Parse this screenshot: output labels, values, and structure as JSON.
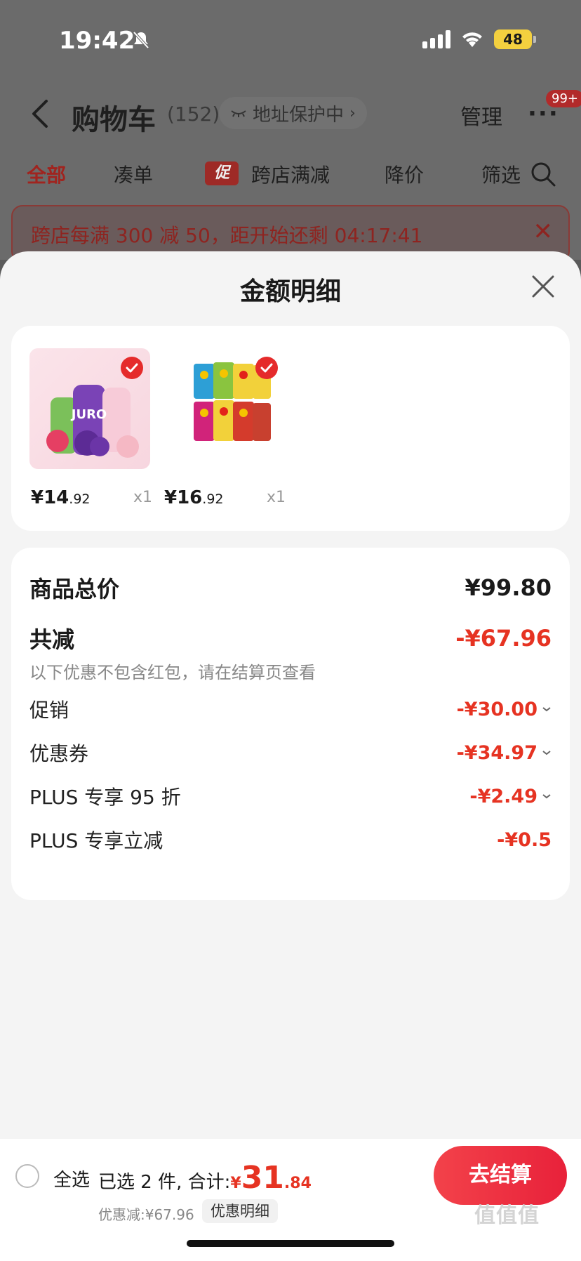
{
  "status_bar": {
    "time": "19:42",
    "battery": "48"
  },
  "nav": {
    "title": "购物车",
    "count": "(152)",
    "address_chip": "地址保护中",
    "manage": "管理",
    "more": "···",
    "badge": "99+"
  },
  "tabs": [
    {
      "label": "全部",
      "active": true
    },
    {
      "label": "凑单",
      "active": false
    },
    {
      "label": "跨店满减",
      "active": false
    },
    {
      "label": "降价",
      "active": false
    },
    {
      "label": "筛选",
      "active": false
    }
  ],
  "promo_icon": "促",
  "promo_banner": {
    "text": "跨店每满 300 减 50，距开始还剩 04:17:41"
  },
  "sheet": {
    "title": "金额明细"
  },
  "products": [
    {
      "price_int": "¥14",
      "price_dec": ".92",
      "qty": "x1",
      "label": "JURO",
      "colors": [
        "#f4c3d3",
        "#6a3aa8",
        "#d13a6a"
      ]
    },
    {
      "price_int": "¥16",
      "price_dec": ".92",
      "qty": "x1",
      "colors": [
        "#f2d13a",
        "#d43b2c",
        "#2d9fd6"
      ]
    }
  ],
  "summary": {
    "total_label": "商品总价",
    "total_value": "¥99.80",
    "discount_label": "共减",
    "discount_value": "-¥67.96",
    "note": "以下优惠不包含红包，请在结算页查看",
    "items": [
      {
        "label": "促销",
        "value": "-¥30.00",
        "expandable": true
      },
      {
        "label": "优惠券",
        "value": "-¥34.97",
        "expandable": true
      },
      {
        "label": "PLUS 专享 95 折",
        "value": "-¥2.49",
        "expandable": true
      },
      {
        "label": "PLUS 专享立减",
        "value": "-¥0.5",
        "expandable": false
      }
    ]
  },
  "bottom": {
    "select_all": "全选",
    "selected_prefix": "已选 2 件, 合计:",
    "total_yen": "¥",
    "total_int": "31",
    "total_dec": ".84",
    "discount": "优惠减:¥67.96",
    "detail_chip": "优惠明细",
    "checkout": "去结算",
    "watermark": "值值值"
  },
  "colors": {
    "accent_red": "#e63322",
    "checkout_red": "#e8213a"
  }
}
